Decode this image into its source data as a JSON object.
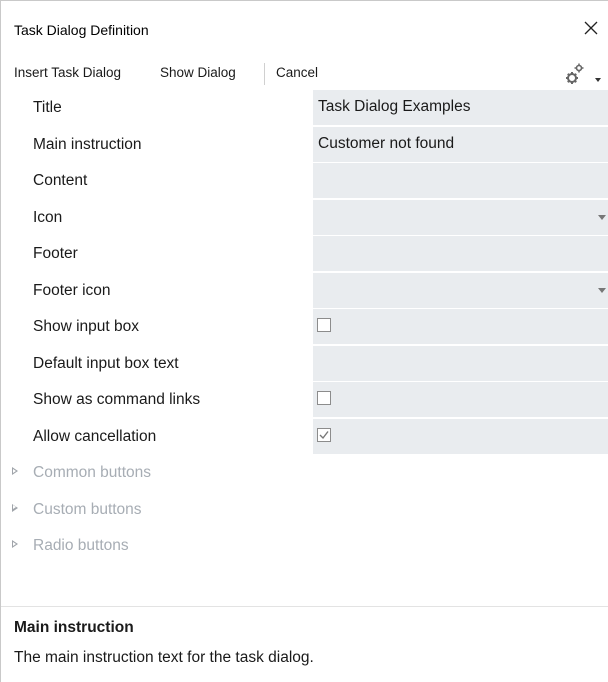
{
  "window": {
    "title": "Task Dialog Definition"
  },
  "toolbar": {
    "insert_label": "Insert Task Dialog",
    "show_label": "Show Dialog",
    "cancel_label": "Cancel"
  },
  "properties": [
    {
      "label": "Title",
      "value": "Task Dialog Examples",
      "type": "text"
    },
    {
      "label": "Main instruction",
      "value": "Customer not found",
      "type": "text"
    },
    {
      "label": "Content",
      "value": "",
      "type": "text"
    },
    {
      "label": "Icon",
      "value": "",
      "type": "dropdown"
    },
    {
      "label": "Footer",
      "value": "",
      "type": "text"
    },
    {
      "label": "Footer icon",
      "value": "",
      "type": "dropdown"
    },
    {
      "label": "Show input box",
      "checked": false,
      "type": "checkbox"
    },
    {
      "label": "Default input box text",
      "value": "",
      "type": "text"
    },
    {
      "label": "Show as command links",
      "checked": false,
      "type": "checkbox"
    },
    {
      "label": "Allow cancellation",
      "checked": true,
      "type": "checkbox"
    }
  ],
  "sections": [
    {
      "label": "Common buttons"
    },
    {
      "label": "Custom buttons"
    },
    {
      "label": "Radio buttons"
    }
  ],
  "description": {
    "title": "Main instruction",
    "text": "The main instruction text for the task dialog."
  }
}
